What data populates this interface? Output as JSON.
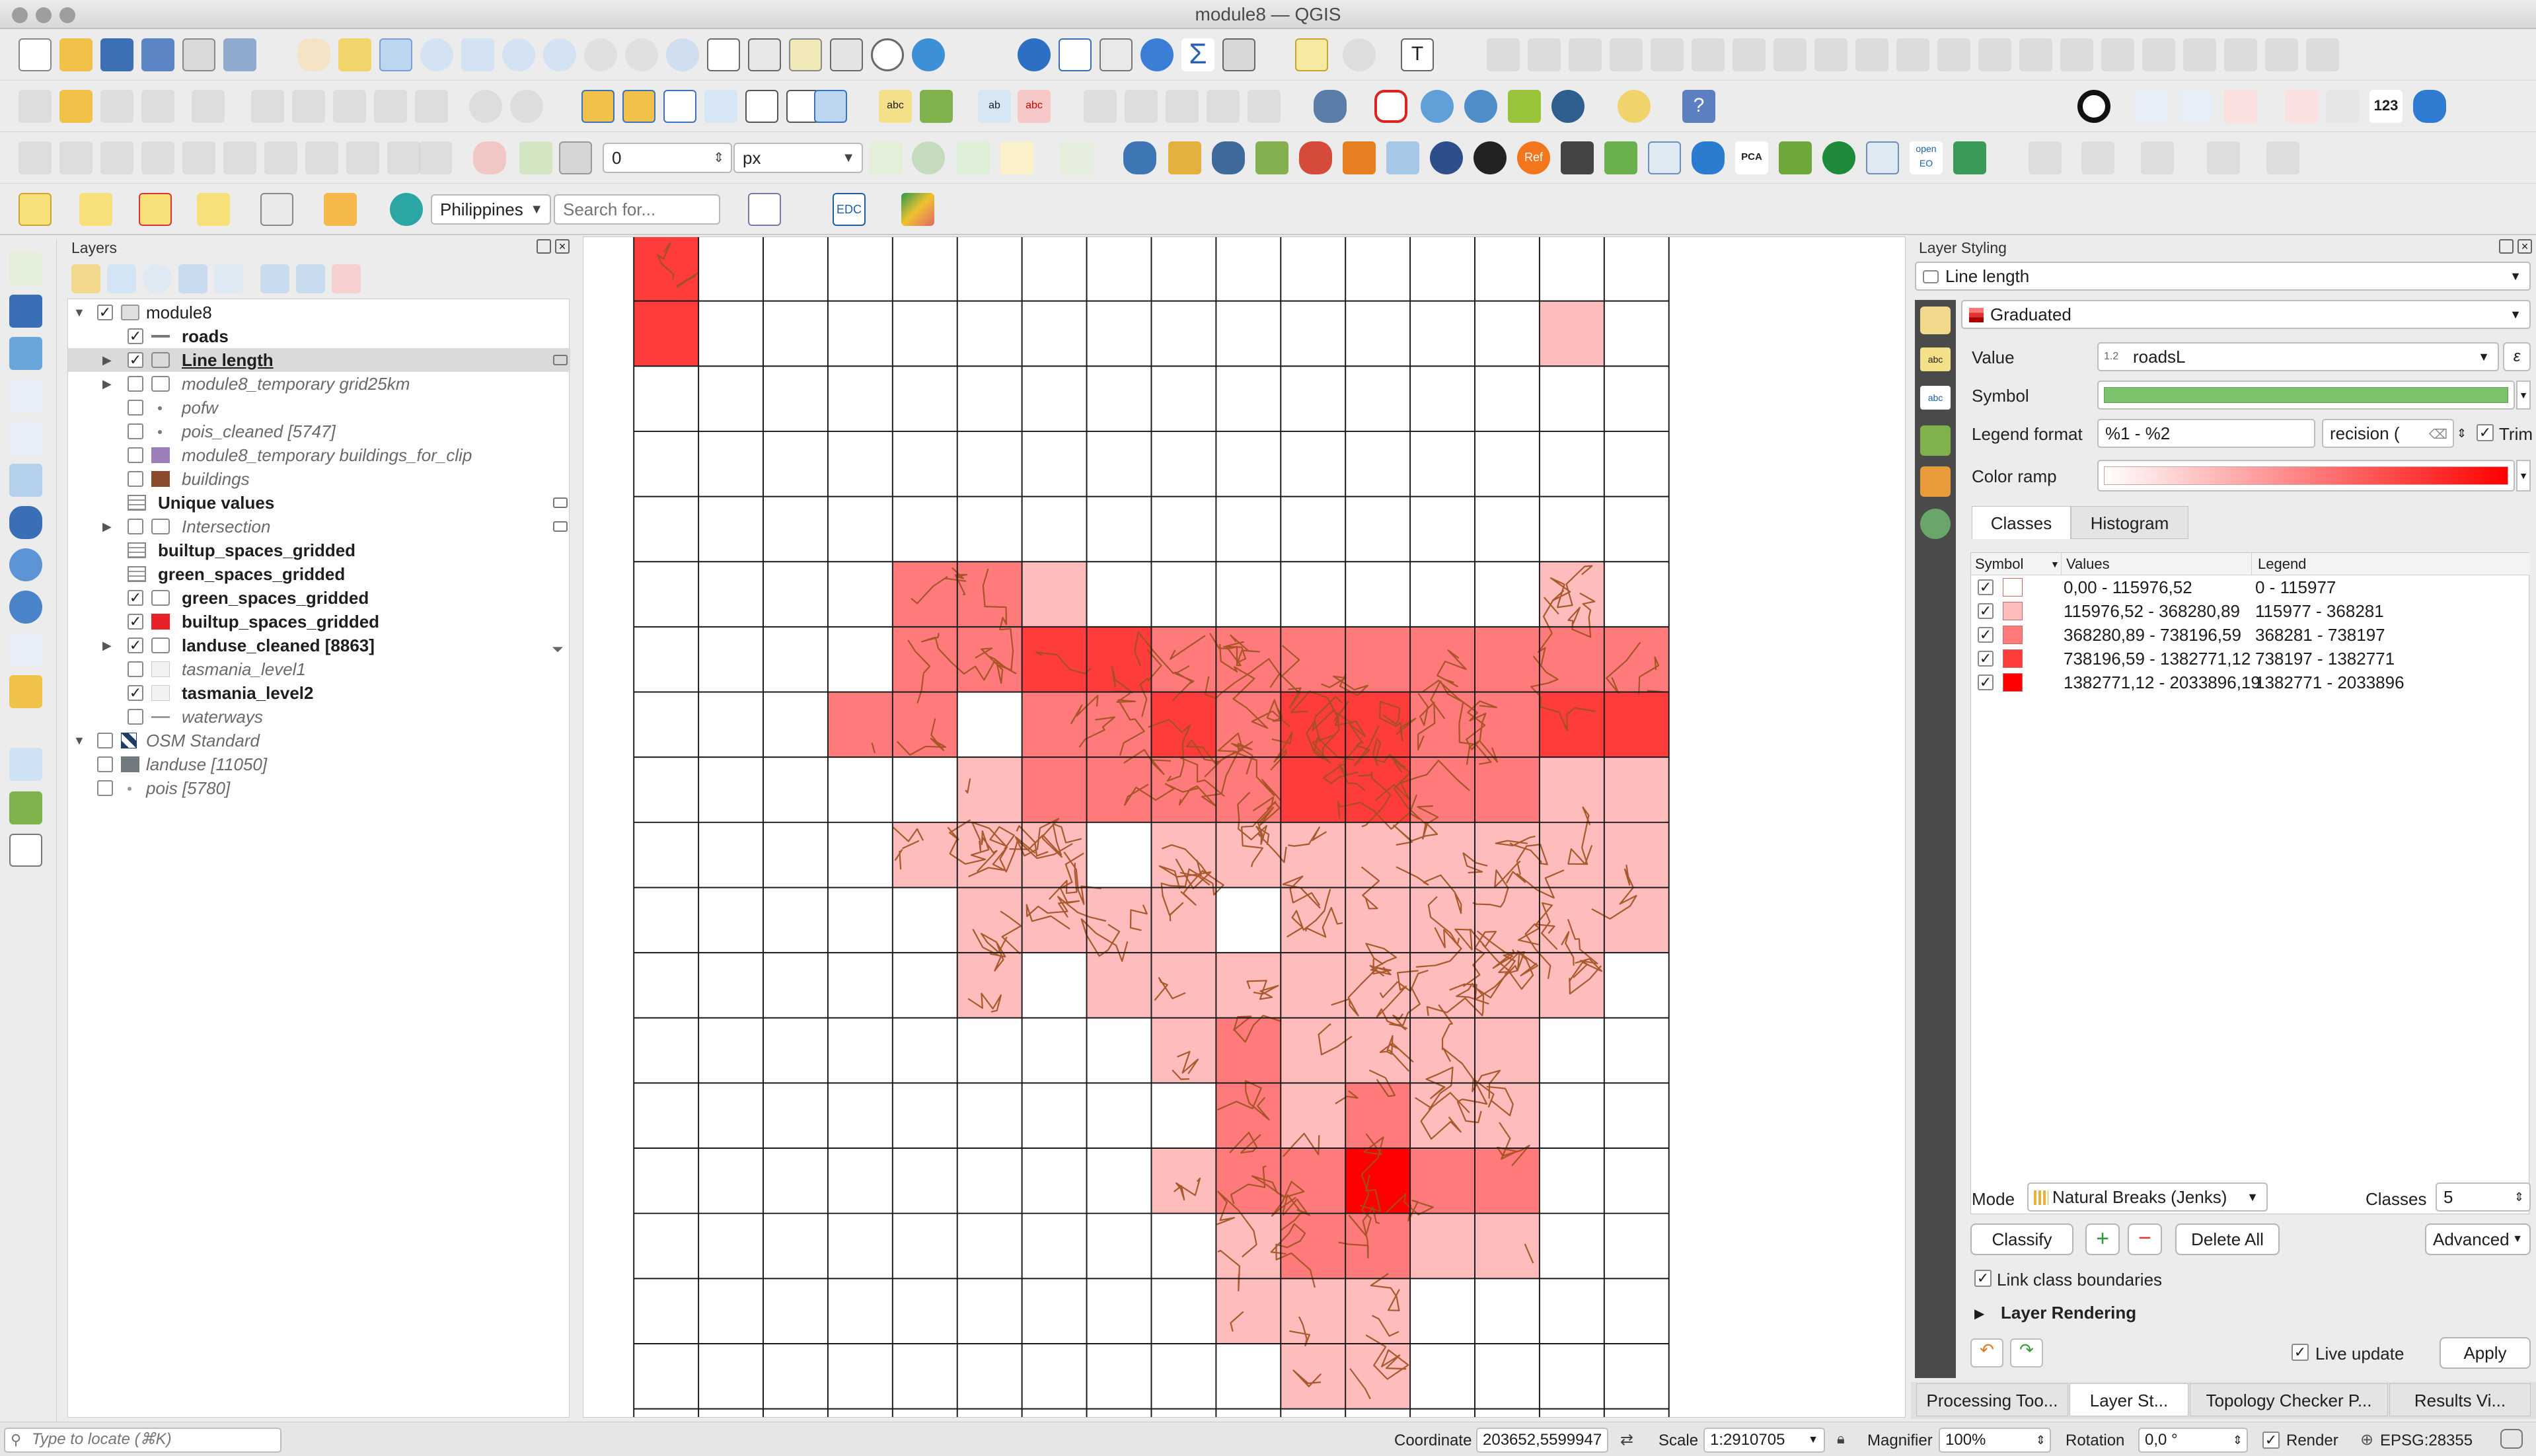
{
  "window": {
    "title": "module8 — QGIS"
  },
  "toolbar": {
    "snapping_tolerance": "0",
    "snapping_unit": "px",
    "locator_country": "Philippines",
    "locator_placeholder": "Search for...",
    "edc_label": "EDC",
    "count_label": "123",
    "openeo_label": "open EO",
    "pca_label": "PCA",
    "ref_label": "Ref"
  },
  "layers_panel": {
    "title": "Layers",
    "items": [
      {
        "label": "module8",
        "checked": true,
        "style": "normal"
      },
      {
        "label": "roads",
        "checked": true,
        "style": "bold"
      },
      {
        "label": "Line length",
        "checked": true,
        "style": "bold"
      },
      {
        "label": "module8_temporary grid25km",
        "checked": false,
        "style": "italic"
      },
      {
        "label": "pofw",
        "checked": false,
        "style": "italic"
      },
      {
        "label": "pois_cleaned [5747]",
        "checked": false,
        "style": "italic"
      },
      {
        "label": "module8_temporary buildings_for_clip",
        "checked": false,
        "style": "italic"
      },
      {
        "label": "buildings",
        "checked": false,
        "style": "italic"
      },
      {
        "label": "Unique values",
        "checked": false,
        "style": "bold"
      },
      {
        "label": "Intersection",
        "checked": false,
        "style": "italic"
      },
      {
        "label": "builtup_spaces_gridded",
        "checked": false,
        "style": "bold"
      },
      {
        "label": "green_spaces_gridded",
        "checked": false,
        "style": "bold"
      },
      {
        "label": "green_spaces_gridded",
        "checked": true,
        "style": "bold"
      },
      {
        "label": "builtup_spaces_gridded",
        "checked": true,
        "style": "bold"
      },
      {
        "label": "landuse_cleaned [8863]",
        "checked": true,
        "style": "bold"
      },
      {
        "label": "tasmania_level1",
        "checked": false,
        "style": "italic"
      },
      {
        "label": "tasmania_level2",
        "checked": true,
        "style": "bold"
      },
      {
        "label": "waterways",
        "checked": false,
        "style": "italic"
      },
      {
        "label": "OSM Standard",
        "checked": false,
        "style": "italic"
      },
      {
        "label": "landuse [11050]",
        "checked": false,
        "style": "italic"
      },
      {
        "label": "pois [5780]",
        "checked": false,
        "style": "italic"
      }
    ]
  },
  "styling_panel": {
    "title": "Layer Styling",
    "layer": "Line length",
    "renderer": "Graduated",
    "value_label": "Value",
    "value_field_prefix": "1.2",
    "value_field": "roadsL",
    "symbol_label": "Symbol",
    "legend_format_label": "Legend format",
    "legend_format": "%1 - %2",
    "precision_label": "recision (",
    "trim_label": "Trim",
    "color_ramp_label": "Color ramp",
    "tabs": [
      "Classes",
      "Histogram"
    ],
    "columns": [
      "Symbol",
      "Values",
      "Legend"
    ],
    "classes": [
      {
        "values": "0,00 - 115976,52",
        "legend": "0 - 115977",
        "color": "#ffffff"
      },
      {
        "values": "115976,52 - 368280,89",
        "legend": "115977 - 368281",
        "color": "#ffbcbc"
      },
      {
        "values": "368280,89 - 738196,59",
        "legend": "368281 - 738197",
        "color": "#ff7b7b"
      },
      {
        "values": "738196,59 - 1382771,12",
        "legend": "738197 - 1382771",
        "color": "#ff3c3c"
      },
      {
        "values": "1382771,12 - 2033896,19",
        "legend": "1382771 - 2033896",
        "color": "#ff0000"
      }
    ],
    "mode_label": "Mode",
    "mode": "Natural Breaks (Jenks)",
    "classes_label": "Classes",
    "classes_count": "5",
    "classify_button": "Classify",
    "delete_all_button": "Delete All",
    "advanced_button": "Advanced",
    "link_boundaries": "Link class boundaries",
    "layer_rendering": "Layer Rendering",
    "live_update": "Live update",
    "apply_button": "Apply",
    "symbol_color": "#7cc16b"
  },
  "bottom_tabs": [
    "Processing Too...",
    "Layer St...",
    "Topology Checker P...",
    "Results Vi..."
  ],
  "status_bar": {
    "locate_placeholder": "Type to locate (⌘K)",
    "coordinate_label": "Coordinate",
    "coordinate": "203652,5599947",
    "scale_label": "Scale",
    "scale": "1:2910705",
    "magnifier_label": "Magnifier",
    "magnifier": "100%",
    "rotation_label": "Rotation",
    "rotation": "0,0 °",
    "render_label": "Render",
    "crs": "EPSG:28355"
  },
  "map_data": {
    "grid_cols": 16,
    "grid_rows": 19,
    "cells": [
      [
        0,
        0,
        3
      ],
      [
        0,
        1,
        3
      ],
      [
        14,
        1,
        1
      ],
      [
        4,
        5,
        2
      ],
      [
        5,
        5,
        2
      ],
      [
        6,
        5,
        1
      ],
      [
        14,
        5,
        1
      ],
      [
        4,
        6,
        2
      ],
      [
        5,
        6,
        2
      ],
      [
        6,
        6,
        3
      ],
      [
        7,
        6,
        3
      ],
      [
        8,
        6,
        2
      ],
      [
        9,
        6,
        2
      ],
      [
        10,
        6,
        2
      ],
      [
        11,
        6,
        2
      ],
      [
        12,
        6,
        2
      ],
      [
        13,
        6,
        2
      ],
      [
        14,
        6,
        2
      ],
      [
        15,
        6,
        2
      ],
      [
        3,
        7,
        2
      ],
      [
        4,
        7,
        2
      ],
      [
        6,
        7,
        2
      ],
      [
        7,
        7,
        2
      ],
      [
        8,
        7,
        3
      ],
      [
        9,
        7,
        2
      ],
      [
        10,
        7,
        3
      ],
      [
        11,
        7,
        3
      ],
      [
        12,
        7,
        2
      ],
      [
        13,
        7,
        2
      ],
      [
        14,
        7,
        3
      ],
      [
        15,
        7,
        3
      ],
      [
        5,
        8,
        1
      ],
      [
        6,
        8,
        2
      ],
      [
        7,
        8,
        2
      ],
      [
        8,
        8,
        2
      ],
      [
        9,
        8,
        2
      ],
      [
        10,
        8,
        3
      ],
      [
        11,
        8,
        3
      ],
      [
        12,
        8,
        2
      ],
      [
        13,
        8,
        2
      ],
      [
        14,
        8,
        1
      ],
      [
        15,
        8,
        1
      ],
      [
        4,
        9,
        1
      ],
      [
        5,
        9,
        1
      ],
      [
        6,
        9,
        1
      ],
      [
        8,
        9,
        1
      ],
      [
        9,
        9,
        1
      ],
      [
        10,
        9,
        1
      ],
      [
        11,
        9,
        1
      ],
      [
        12,
        9,
        1
      ],
      [
        13,
        9,
        1
      ],
      [
        14,
        9,
        1
      ],
      [
        15,
        9,
        1
      ],
      [
        5,
        10,
        1
      ],
      [
        6,
        10,
        1
      ],
      [
        7,
        10,
        1
      ],
      [
        8,
        10,
        1
      ],
      [
        10,
        10,
        1
      ],
      [
        11,
        10,
        1
      ],
      [
        12,
        10,
        1
      ],
      [
        13,
        10,
        1
      ],
      [
        14,
        10,
        1
      ],
      [
        15,
        10,
        1
      ],
      [
        5,
        11,
        1
      ],
      [
        7,
        11,
        1
      ],
      [
        8,
        11,
        1
      ],
      [
        9,
        11,
        1
      ],
      [
        10,
        11,
        1
      ],
      [
        11,
        11,
        1
      ],
      [
        12,
        11,
        1
      ],
      [
        13,
        11,
        1
      ],
      [
        14,
        11,
        1
      ],
      [
        8,
        12,
        1
      ],
      [
        9,
        12,
        2
      ],
      [
        10,
        12,
        1
      ],
      [
        11,
        12,
        1
      ],
      [
        12,
        12,
        1
      ],
      [
        13,
        12,
        1
      ],
      [
        9,
        13,
        2
      ],
      [
        10,
        13,
        1
      ],
      [
        11,
        13,
        2
      ],
      [
        12,
        13,
        1
      ],
      [
        13,
        13,
        1
      ],
      [
        8,
        14,
        1
      ],
      [
        9,
        14,
        2
      ],
      [
        10,
        14,
        2
      ],
      [
        11,
        14,
        4
      ],
      [
        12,
        14,
        2
      ],
      [
        13,
        14,
        2
      ],
      [
        9,
        15,
        1
      ],
      [
        10,
        15,
        2
      ],
      [
        11,
        15,
        2
      ],
      [
        12,
        15,
        1
      ],
      [
        13,
        15,
        1
      ],
      [
        9,
        16,
        1
      ],
      [
        10,
        16,
        1
      ],
      [
        11,
        16,
        1
      ],
      [
        10,
        17,
        1
      ],
      [
        11,
        17,
        1
      ]
    ]
  }
}
